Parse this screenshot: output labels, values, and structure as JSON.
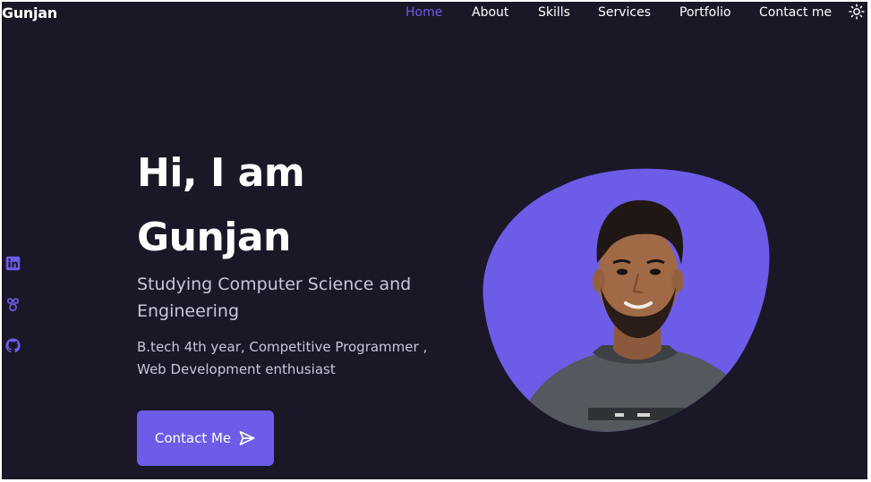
{
  "header": {
    "logo": "Gunjan",
    "nav": [
      {
        "label": "Home",
        "active": true
      },
      {
        "label": "About",
        "active": false
      },
      {
        "label": "Skills",
        "active": false
      },
      {
        "label": "Services",
        "active": false
      },
      {
        "label": "Portfolio",
        "active": false
      },
      {
        "label": "Contact me",
        "active": false
      }
    ],
    "theme_icon": "sun-icon"
  },
  "social": [
    {
      "icon": "linkedin-icon"
    },
    {
      "icon": "dribbble-icon"
    },
    {
      "icon": "github-icon"
    }
  ],
  "hero": {
    "greeting_line1": "Hi, I am",
    "greeting_line2": "Gunjan",
    "subtitle_line1": "Studying Computer Science and",
    "subtitle_line2": "Engineering",
    "desc_line1": "B.tech 4th year, Competitive Programmer ,",
    "desc_line2": "Web Development enthusiast",
    "button_label": "Contact Me",
    "button_icon": "send-icon",
    "image": "profile-photo"
  },
  "colors": {
    "background": "#1a1727",
    "accent": "#6c5ce7",
    "text": "#ffffff",
    "muted_text": "#c9c6d9"
  }
}
